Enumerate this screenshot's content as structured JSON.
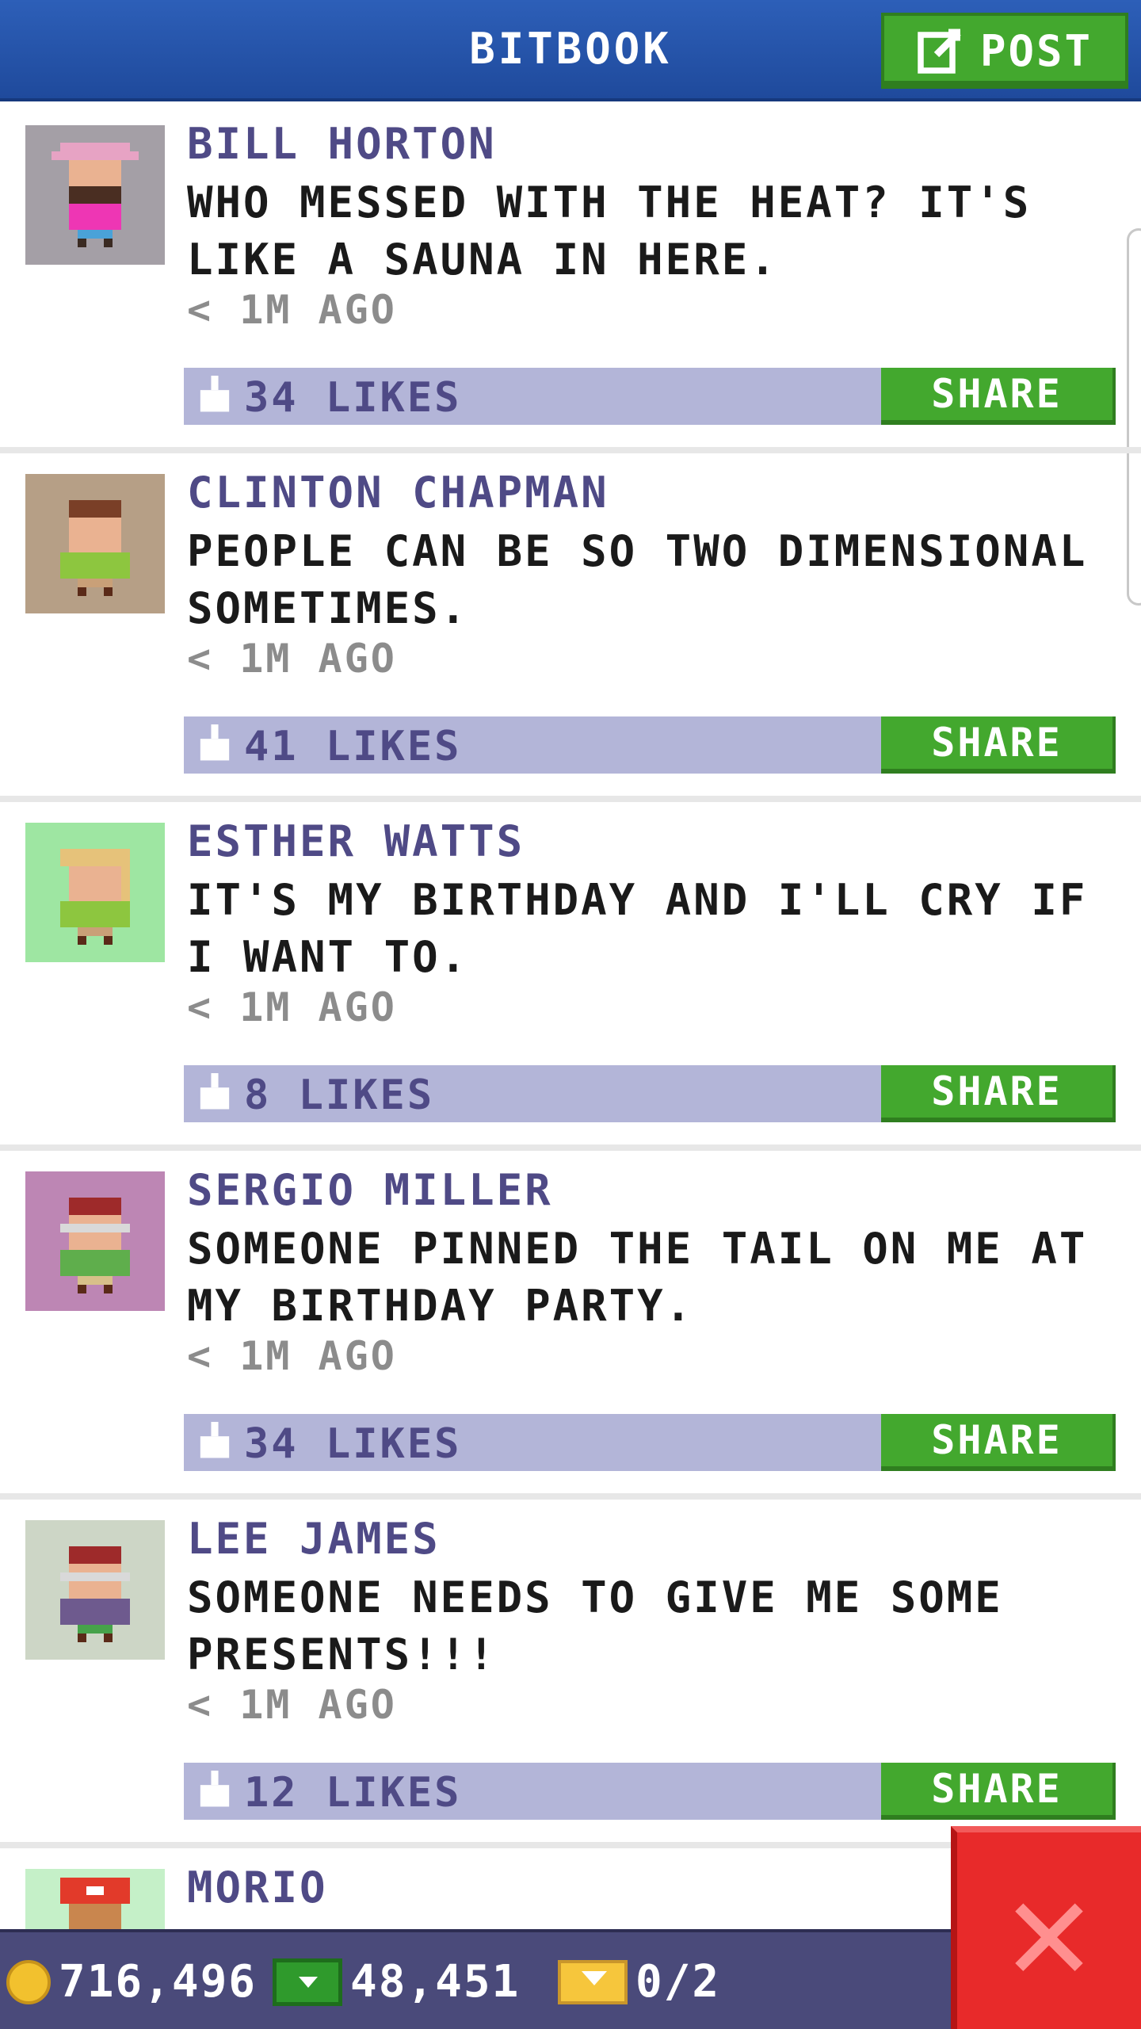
{
  "header": {
    "title": "BITBOOK",
    "post_label": "POST"
  },
  "posts": [
    {
      "name": "BILL HORTON",
      "message": "WHO MESSED WITH THE HEAT? IT'S LIKE A SAUNA IN HERE.",
      "time": "< 1M AGO",
      "likes": "34 LIKES",
      "share_label": "SHARE",
      "avatar_bg": "#a49fa6"
    },
    {
      "name": "CLINTON CHAPMAN",
      "message": "PEOPLE CAN BE SO TWO DIMENSIONAL SOMETIMES.",
      "time": "< 1M AGO",
      "likes": "41 LIKES",
      "share_label": "SHARE",
      "avatar_bg": "#b69f86"
    },
    {
      "name": "ESTHER WATTS",
      "message": "IT'S MY BIRTHDAY AND I'LL CRY IF I WANT TO.",
      "time": "< 1M AGO",
      "likes": "8 LIKES",
      "share_label": "SHARE",
      "avatar_bg": "#9ee6a2"
    },
    {
      "name": "SERGIO MILLER",
      "message": "SOMEONE PINNED THE TAIL ON ME AT MY BIRTHDAY PARTY.",
      "time": "< 1M AGO",
      "likes": "34 LIKES",
      "share_label": "SHARE",
      "avatar_bg": "#bd86b4"
    },
    {
      "name": "LEE JAMES",
      "message": "SOMEONE NEEDS TO GIVE ME SOME PRESENTS!!!",
      "time": "< 1M AGO",
      "likes": "12 LIKES",
      "share_label": "SHARE",
      "avatar_bg": "#cdd6c6"
    },
    {
      "name": "MORIO",
      "avatar_bg": "#c5f0c8"
    }
  ],
  "status": {
    "coins": "716,496",
    "bux": "48,451",
    "tickets": "0/2"
  },
  "icons": {
    "post": "edit-icon",
    "like": "thumbs-up-icon",
    "coin": "coin-icon",
    "bux": "bux-icon",
    "ticket": "ticket-icon",
    "close": "close-icon"
  },
  "colors": {
    "header_blue": "#2d5fb8",
    "accent_green": "#43a82e",
    "like_bar": "#b3b5d8",
    "name_purple": "#4f4a86",
    "close_red": "#e82a2a"
  }
}
